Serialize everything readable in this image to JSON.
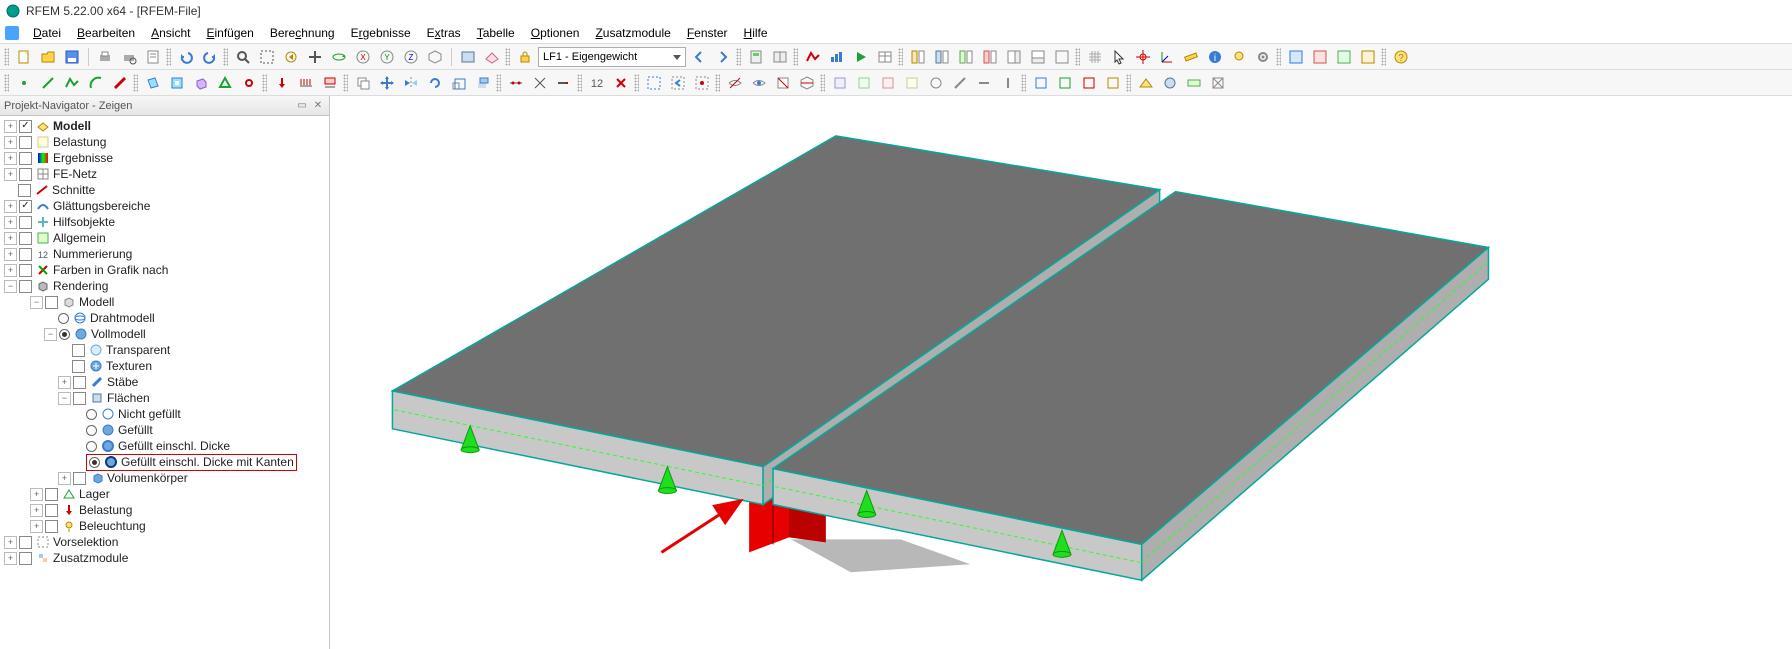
{
  "window": {
    "title": "RFEM 5.22.00 x64 - [RFEM-File]"
  },
  "menu": {
    "items": [
      "Datei",
      "Bearbeiten",
      "Ansicht",
      "Einfügen",
      "Berechnung",
      "Ergebnisse",
      "Extras",
      "Tabelle",
      "Optionen",
      "Zusatzmodule",
      "Fenster",
      "Hilfe"
    ]
  },
  "toolbar1": {
    "loadcase": "LF1 - Eigengewicht"
  },
  "panel": {
    "title": "Projekt-Navigator - Zeigen"
  },
  "tree": {
    "n0": "Modell",
    "n1": "Belastung",
    "n2": "Ergebnisse",
    "n3": "FE-Netz",
    "n4": "Schnitte",
    "n5": "Glättungsbereiche",
    "n6": "Hilfsobjekte",
    "n7": "Allgemein",
    "n8": "Nummerierung",
    "n9": "Farben in Grafik nach",
    "n10": "Rendering",
    "n10_0": "Modell",
    "n10_0_0": "Drahtmodell",
    "n10_0_1": "Vollmodell",
    "n10_0_1_0": "Transparent",
    "n10_0_1_1": "Texturen",
    "n10_0_1_2": "Stäbe",
    "n10_0_1_3": "Flächen",
    "n10_0_1_3_0": "Nicht gefüllt",
    "n10_0_1_3_1": "Gefüllt",
    "n10_0_1_3_2": "Gefüllt einschl. Dicke",
    "n10_0_1_3_3": "Gefüllt einschl. Dicke mit Kanten",
    "n10_0_1_4": "Volumenkörper",
    "n10_1": "Lager",
    "n10_2": "Belastung",
    "n10_3": "Beleuchtung",
    "n11": "Vorselektion",
    "n12": "Zusatzmodule"
  }
}
